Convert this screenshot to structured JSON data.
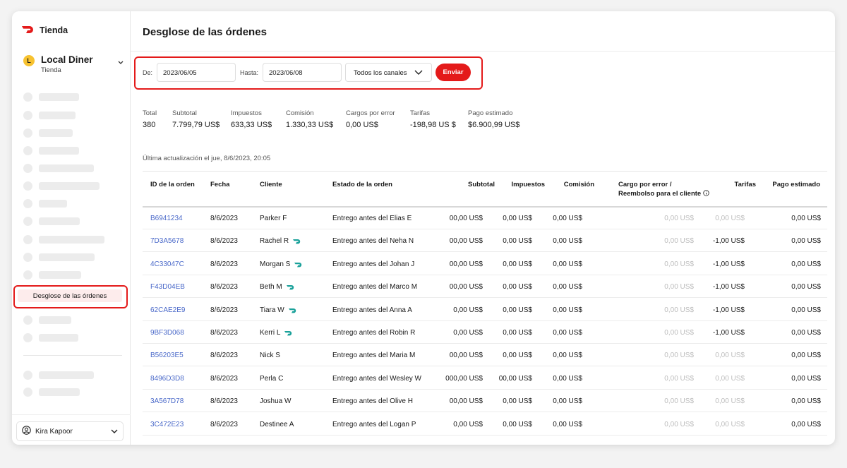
{
  "sidebar": {
    "brand": "Tienda",
    "store_name": "Local Diner",
    "store_initial": "L",
    "store_sub": "Tienda",
    "active_item": "Desglose de las órdenes",
    "user": "Kira Kapoor"
  },
  "page": {
    "title": "Desglose de las órdenes"
  },
  "filters": {
    "from_label": "De:",
    "from_value": "2023/06/05",
    "to_label": "Hasta:",
    "to_value": "2023/06/08",
    "channel": "Todos los canales",
    "submit": "Enviar"
  },
  "summary": [
    {
      "label": "Total",
      "value": "380"
    },
    {
      "label": "Subtotal",
      "value": "7.799,79 US$"
    },
    {
      "label": "Impuestos",
      "value": "633,33 US$"
    },
    {
      "label": "Comisión",
      "value": "1.330,33 US$"
    },
    {
      "label": "Cargos por error",
      "value": "0,00 US$"
    },
    {
      "label": "Tarifas",
      "value": "-198,98 US $"
    },
    {
      "label": "Pago estimado",
      "value": "$6.900,99 US$"
    }
  ],
  "updated": "Última actualización el jue, 8/6/2023, 20:05",
  "table": {
    "headers": {
      "order_id": "ID de la orden",
      "date": "Fecha",
      "customer": "Cliente",
      "status": "Estado de la orden",
      "subtotal": "Subtotal",
      "taxes": "Impuestos",
      "commission": "Comisión",
      "error_line1": "Cargo por error /",
      "error_line2": "Reembolso para el cliente",
      "fees": "Tarifas",
      "payout": "Pago estimado"
    },
    "rows": [
      {
        "id": "B6941234",
        "date": "8/6/2023",
        "customer": "Parker F",
        "dash": false,
        "status": "Entrego antes del Elias E",
        "subtotal": "00,00 US$",
        "taxes": "0,00 US$",
        "commission": "0,00 US$",
        "error": "0,00 US$",
        "fees": "0,00 US$",
        "fees_muted": true,
        "payout": "0,00 US$"
      },
      {
        "id": "7D3A5678",
        "date": "8/6/2023",
        "customer": "Rachel R",
        "dash": true,
        "status": "Entrego antes del Neha N",
        "subtotal": "00,00 US$",
        "taxes": "0,00 US$",
        "commission": "0,00 US$",
        "error": "0,00 US$",
        "fees": "-1,00 US$",
        "fees_muted": false,
        "payout": "0,00 US$"
      },
      {
        "id": "4C33047C",
        "date": "8/6/2023",
        "customer": "Morgan S",
        "dash": true,
        "status": "Entrego antes del Johan J",
        "subtotal": "00,00 US$",
        "taxes": "0,00 US$",
        "commission": "0,00 US$",
        "error": "0,00 US$",
        "fees": "-1,00 US$",
        "fees_muted": false,
        "payout": "0,00 US$"
      },
      {
        "id": "F43D04EB",
        "date": "8/6/2023",
        "customer": "Beth M",
        "dash": true,
        "status": "Entrego antes del Marco M",
        "subtotal": "00,00 US$",
        "taxes": "0,00 US$",
        "commission": "0,00 US$",
        "error": "0,00 US$",
        "fees": "-1,00 US$",
        "fees_muted": false,
        "payout": "0,00 US$"
      },
      {
        "id": "62CAE2E9",
        "date": "8/6/2023",
        "customer": "Tiara W",
        "dash": true,
        "status": "Entrego antes del Anna A",
        "subtotal": "0,00 US$",
        "taxes": "0,00 US$",
        "commission": "0,00 US$",
        "error": "0,00 US$",
        "fees": "-1,00 US$",
        "fees_muted": false,
        "payout": "0,00 US$"
      },
      {
        "id": "9BF3D068",
        "date": "8/6/2023",
        "customer": "Kerri L",
        "dash": true,
        "status": "Entrego antes del Robin R",
        "subtotal": "0,00 US$",
        "taxes": "0,00 US$",
        "commission": "0,00 US$",
        "error": "0,00 US$",
        "fees": "-1,00 US$",
        "fees_muted": false,
        "payout": "0,00 US$"
      },
      {
        "id": "B56203E5",
        "date": "8/6/2023",
        "customer": "Nick S",
        "dash": false,
        "status": "Entrego antes del Maria M",
        "subtotal": "00,00 US$",
        "taxes": "0,00 US$",
        "commission": "0,00 US$",
        "error": "0,00 US$",
        "fees": "0,00 US$",
        "fees_muted": true,
        "payout": "0,00 US$"
      },
      {
        "id": "8496D3D8",
        "date": "8/6/2023",
        "customer": "Perla C",
        "dash": false,
        "status": "Entrego antes del Wesley W",
        "subtotal": "000,00 US$",
        "taxes": "00,00 US$",
        "commission": "0,00 US$",
        "error": "0,00 US$",
        "fees": "0,00 US$",
        "fees_muted": true,
        "payout": "0,00 US$"
      },
      {
        "id": "3A567D78",
        "date": "8/6/2023",
        "customer": "Joshua W",
        "dash": false,
        "status": "Entrego antes del Olive H",
        "subtotal": "00,00 US$",
        "taxes": "0,00 US$",
        "commission": "0,00 US$",
        "error": "0,00 US$",
        "fees": "0,00 US$",
        "fees_muted": true,
        "payout": "0,00 US$"
      },
      {
        "id": "3C472E23",
        "date": "8/6/2023",
        "customer": "Destinee A",
        "dash": false,
        "status": "Entrego antes del Logan P",
        "subtotal": "0,00 US$",
        "taxes": "0,00 US$",
        "commission": "0,00 US$",
        "error": "0,00 US$",
        "fees": "0,00 US$",
        "fees_muted": true,
        "payout": "0,00 US$"
      }
    ]
  },
  "colors": {
    "accent": "#e41a1a",
    "link": "#4a69c9",
    "dasher_icon": "#1aa19a"
  }
}
